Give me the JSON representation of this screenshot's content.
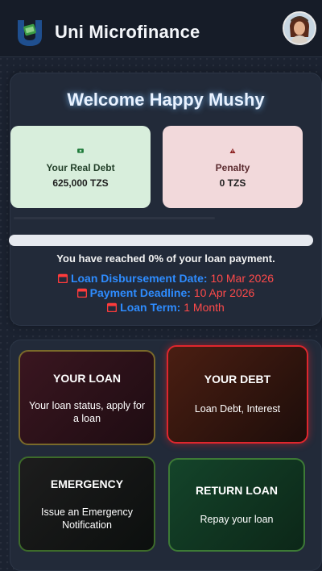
{
  "header": {
    "app_title": "Uni Microfinance",
    "logo_icon": "uni-logo-shield",
    "avatar": "user-avatar"
  },
  "welcome": {
    "greeting": "Welcome Happy Mushy"
  },
  "stats": {
    "real_debt": {
      "label": "Your Real Debt",
      "value": "625,000 TZS",
      "icon": "money-icon"
    },
    "penalty": {
      "label": "Penalty",
      "value": "0 TZS",
      "icon": "warning-icon"
    }
  },
  "progress": {
    "percent": 0,
    "text": "You have reached 0% of your loan payment."
  },
  "loan_info": {
    "disbursement": {
      "label": "Loan Disbursement Date:",
      "value": "10 Mar 2026"
    },
    "deadline": {
      "label": "Payment Deadline:",
      "value": "10 Apr 2026"
    },
    "term": {
      "label": "Loan Term:",
      "value": "1 Month"
    }
  },
  "menu": {
    "your_loan": {
      "title": "YOUR LOAN",
      "subtitle": "Your loan status, apply for a loan"
    },
    "your_debt": {
      "title": "YOUR DEBT",
      "subtitle": "Loan Debt, Interest"
    },
    "emergency": {
      "title": "EMERGENCY",
      "subtitle": "Issue an Emergency Notification"
    },
    "return_loan": {
      "title": "RETURN LOAN",
      "subtitle": "Repay your loan"
    }
  },
  "colors": {
    "accent_blue": "#2e8cff",
    "alert_red": "#ff4a4a",
    "debt_green": "#d8eedc",
    "penalty_pink": "#f2d9db"
  }
}
